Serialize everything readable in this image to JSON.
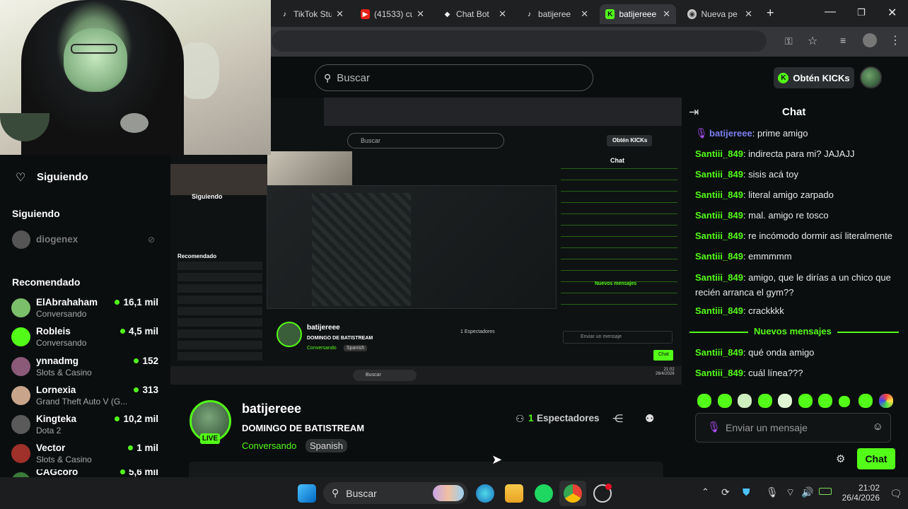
{
  "browser": {
    "tabs": [
      {
        "label": "TikTok Stu",
        "icon": "tiktok-icon"
      },
      {
        "label": "(41533) cu",
        "icon": "youtube-icon"
      },
      {
        "label": "Chat Bot",
        "icon": "chatbot-icon"
      },
      {
        "label": "batijeree",
        "icon": "tiktok-icon"
      },
      {
        "label": "batijereee",
        "icon": "kick-icon",
        "active": true
      },
      {
        "label": "Nueva pe",
        "icon": "chrome-icon"
      }
    ]
  },
  "header": {
    "search_placeholder": "Buscar",
    "kicks_label": "Obtén KICKs"
  },
  "sidebar": {
    "following_header": "Siguiendo",
    "following_section": "Siguiendo",
    "following_users": [
      {
        "name": "diogenex"
      }
    ],
    "recommended_header": "Recomendado",
    "recommended": [
      {
        "name": "ElAbrahaham",
        "category": "Conversando",
        "viewers": "16,1 mil",
        "color": "#7cbf6a"
      },
      {
        "name": "Robleis",
        "category": "Conversando",
        "viewers": "4,5 mil",
        "color": "#53fc18"
      },
      {
        "name": "ynnadmg",
        "category": "Slots & Casino",
        "viewers": "152",
        "color": "#8a5a78"
      },
      {
        "name": "Lornexia",
        "category": "Grand Theft Auto V (G...",
        "viewers": "313",
        "color": "#c8a58a"
      },
      {
        "name": "Kingteka",
        "category": "Dota 2",
        "viewers": "10,2 mil",
        "color": "#5a5a5a"
      },
      {
        "name": "Vector",
        "category": "Slots & Casino",
        "viewers": "1 mil",
        "color": "#a0302a"
      },
      {
        "name": "CAGcoro",
        "category": "",
        "viewers": "5,6 mil",
        "color": "#3a7a3a"
      }
    ]
  },
  "streamer": {
    "name": "batijereee",
    "title": "DOMINGO DE BATISTREAM",
    "category": "Conversando",
    "language_tag": "Spanish",
    "live_badge": "LIVE",
    "viewers_count": "1",
    "viewers_label": "Espectadores"
  },
  "chat": {
    "title": "Chat",
    "messages": [
      {
        "user": "batijereee",
        "text": "prime amigo",
        "broadcaster": true
      },
      {
        "user": "Santiii_849",
        "text": "indirecta para mi? JAJAJJ"
      },
      {
        "user": "Santiii_849",
        "text": "sisis acá toy"
      },
      {
        "user": "Santiii_849",
        "text": "literal amigo zarpado"
      },
      {
        "user": "Santiii_849",
        "text": "mal. amigo re tosco"
      },
      {
        "user": "Santiii_849",
        "text": "re incómodo dormir así literalmente"
      },
      {
        "user": "Santiii_849",
        "text": "emmmmm"
      },
      {
        "user": "Santiii_849",
        "text": "amigo, que le dirías a un chico que recién arranca el gym??"
      },
      {
        "user": "Santiii_849",
        "text": "crackkkk"
      }
    ],
    "new_messages_label": "Nuevos mensajes",
    "new_messages": [
      {
        "user": "Santiii_849",
        "text": "qué onda amigo"
      },
      {
        "user": "Santiii_849",
        "text": "cuál línea???"
      }
    ],
    "input_placeholder": "Enviar un mensaje",
    "send_label": "Chat"
  },
  "taskbar": {
    "search_label": "Buscar",
    "time": "21:02",
    "date": "26/4/2026"
  },
  "nested": {
    "search": "Buscar",
    "kicks": "Obtén KICKs",
    "chat_title": "Chat",
    "following": "Siguiendo",
    "recommended": "Recomendado",
    "streamer": "batijereee",
    "title": "DOMINGO DE BATISTREAM",
    "category": "Conversando",
    "language": "Spanish",
    "viewers": "1 Espectadores",
    "new_messages": "Nuevos mensajes",
    "input": "Enviar un mensaje",
    "send": "Chat",
    "time": "21:02",
    "date": "26/4/2026"
  }
}
